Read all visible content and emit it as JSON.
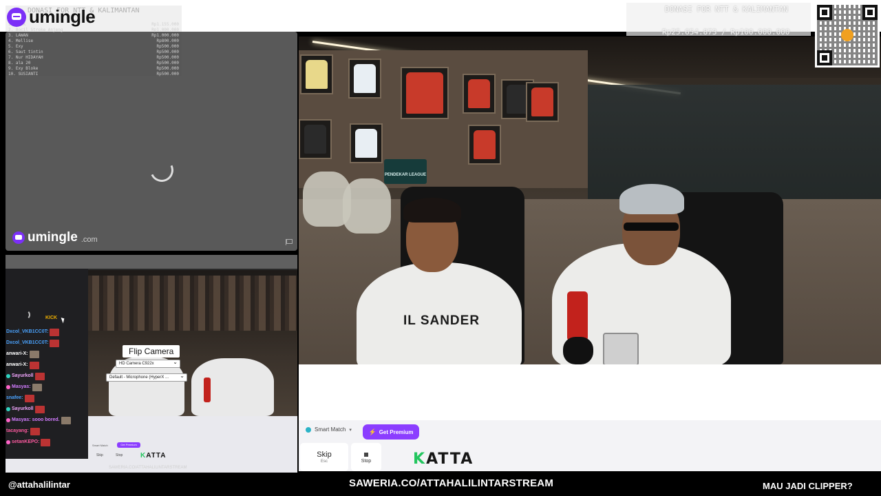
{
  "brand": {
    "name": "umingle",
    "domain": ".com"
  },
  "leaderboard": {
    "title": "DONASI FOR NTT & KALIMANTAN",
    "rows": [
      {
        "rank": "1. BDSK",
        "amount": "Rp1.155.000"
      },
      {
        "rank": "2. Bocil Stroke Anjeng",
        "amount": "Rp1.000.000"
      },
      {
        "rank": "3. LAWAN",
        "amount": "Rp1.000.000"
      },
      {
        "rank": "4. Mellise",
        "amount": "Rp800.000"
      },
      {
        "rank": "5. Exy",
        "amount": "Rp500.000"
      },
      {
        "rank": "6. Saut tintin",
        "amount": "Rp500.000"
      },
      {
        "rank": "7. Nur HIDAYAH",
        "amount": "Rp500.000"
      },
      {
        "rank": "8. ala 20",
        "amount": "Rp500.000"
      },
      {
        "rank": "9. Exy Bloke",
        "amount": "Rp500.000"
      },
      {
        "rank": "10. SUSIANTI",
        "amount": "Rp500.000"
      }
    ]
  },
  "donation": {
    "title": "DONASI FOR NTT & KALIMANTAN",
    "amount": "Rp25.654.873 / Rp100.000.000"
  },
  "capture": {
    "kick_label": "KICK",
    "flip_camera": "Flip Camera",
    "camera_option": "HD Camera C922x",
    "mic_option": "Default - Microphone (HyperX ...",
    "chat": [
      {
        "user": "Dxcol_VKB1CC0T:",
        "color": "#4aa3ff",
        "badge": ""
      },
      {
        "user": "Dxcol_VKB1CC0T:",
        "color": "#4aa3ff",
        "badge": ""
      },
      {
        "user": "anwari-X:",
        "color": "#ffffff",
        "badge": ""
      },
      {
        "user": "anwari-X:",
        "color": "#ffffff",
        "badge": ""
      },
      {
        "user": "Sayurkoll",
        "color": "#f3a7ff",
        "badge": "#2fd3c0"
      },
      {
        "user": "Masyas:",
        "color": "#d27cff",
        "badge": "#ff63c8"
      },
      {
        "user": "snafee:",
        "color": "#4aa3ff",
        "badge": ""
      },
      {
        "user": "Sayurkoll",
        "color": "#f3a7ff",
        "badge": "#2fd3c0"
      },
      {
        "user": "Masyas: sooo bored.",
        "color": "#d27cff",
        "badge": "#ff63c8"
      },
      {
        "user": "tacayang:",
        "color": "#ff5aa0",
        "badge": ""
      },
      {
        "user": "setanKEPO:",
        "color": "#ff5aa0",
        "badge": "#ff63c8"
      }
    ],
    "mini_smart_match": "Smart Match",
    "mini_premium": "Get Premium",
    "mini_skip": "Skip",
    "mini_stop": "Stop",
    "mini_katta": "ATTA",
    "mini_katta_k": "K",
    "mini_saweria": "SAWERIA.CO/ATTAHALILINTARSTREAM"
  },
  "video": {
    "shirt_print": "IL SANDER",
    "league_sign": "PENDEKAR LEAGUE"
  },
  "controls": {
    "smart_match": "Smart Match",
    "get_premium": "Get Premium",
    "skip": "Skip",
    "skip_key": "Esc",
    "stop": "Stop",
    "katta_k": "K",
    "katta_rest": "ATTA"
  },
  "footer": {
    "handle": "@attahalilintar",
    "saweria": "SAWERIA.CO/ATTAHALILINTARSTREAM",
    "clipper": "MAU JADI CLIPPER?"
  },
  "colors": {
    "accent": "#8b3dff",
    "katta_green": "#22c55e"
  }
}
